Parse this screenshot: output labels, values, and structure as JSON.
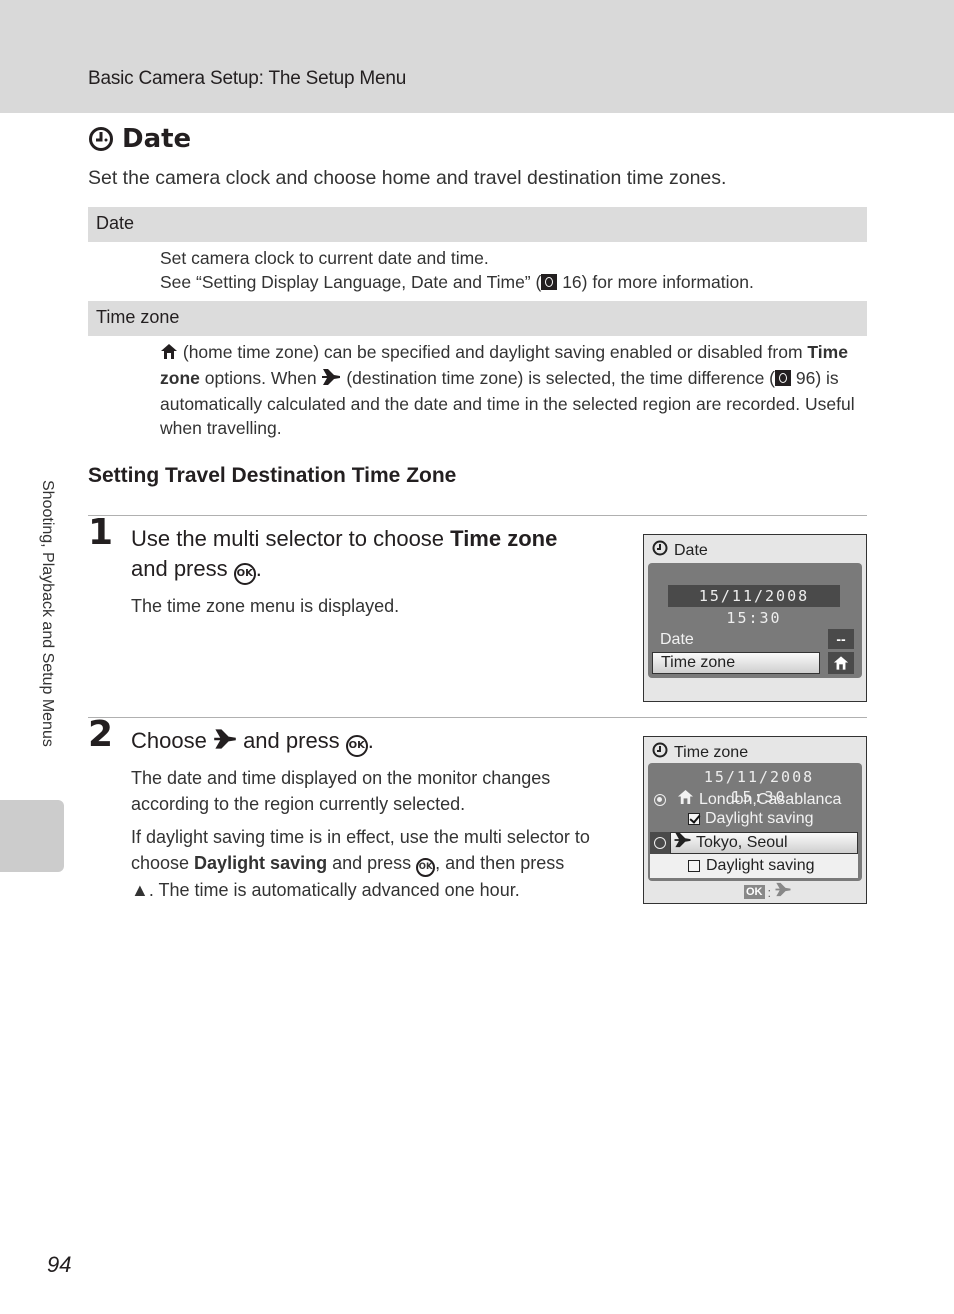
{
  "header": {
    "title": "Basic Camera Setup: The Setup Menu"
  },
  "page": {
    "title": "Date",
    "title_icon": "clock-icon",
    "intro": "Set the camera clock and choose home and travel destination time zones.",
    "page_number": "94",
    "side_tab": "Shooting, Playback and Setup Menus"
  },
  "sections": [
    {
      "label": "Date",
      "line1": "Set camera clock to current date and time.",
      "line2_pre": "See “Setting Display Language, Date and Time” (",
      "line2_ref": "16",
      "line2_post": ") for more information."
    },
    {
      "label": "Time zone",
      "p1": " (home time zone) can be specified and daylight saving enabled or disabled from ",
      "p1_bold": "Time zone",
      "p2": " options. When ",
      "p3": " (destination time zone) is selected, the time difference (",
      "p3_ref": "96",
      "p4": ") is automatically calculated and the date and time in the selected region are recorded. Useful when travelling."
    }
  ],
  "subheading": "Setting Travel Destination Time Zone",
  "steps": [
    {
      "number": "1",
      "title_pre": "Use the multi selector to choose ",
      "title_bold": "Time zone",
      "title_post1": "and press ",
      "title_post2": ".",
      "body": "The time zone menu is displayed."
    },
    {
      "number": "2",
      "title_pre": "Choose ",
      "title_mid": " and press ",
      "title_post": ".",
      "body1": "The date and time displayed on the monitor changes according to the region currently selected.",
      "body2_pre": "If daylight saving time is in effect, use the multi selector to choose ",
      "body2_bold": "Daylight saving",
      "body2_mid": " and press ",
      "body2_post": ", and then press ",
      "body2_end": ". The time is automatically advanced one hour."
    }
  ],
  "screens": {
    "date_screen": {
      "title": "Date",
      "datetime": "15/11/2008  15:30",
      "items": [
        {
          "label": "Date",
          "value": "--"
        },
        {
          "label": "Time zone",
          "value_icon": "home-icon",
          "selected": true
        }
      ]
    },
    "tz_screen": {
      "title": "Time zone",
      "datetime": "15/11/2008   15:30",
      "home_city": "London,Casablanca",
      "home_daylight": "Daylight saving",
      "home_daylight_checked": true,
      "dest_city": "Tokyo, Seoul",
      "dest_daylight": "Daylight saving",
      "dest_daylight_checked": false,
      "footer_ok": "OK",
      "footer_sep": ":"
    }
  },
  "glyphs": {
    "ok": "OK",
    "up_triangle": "▲"
  }
}
